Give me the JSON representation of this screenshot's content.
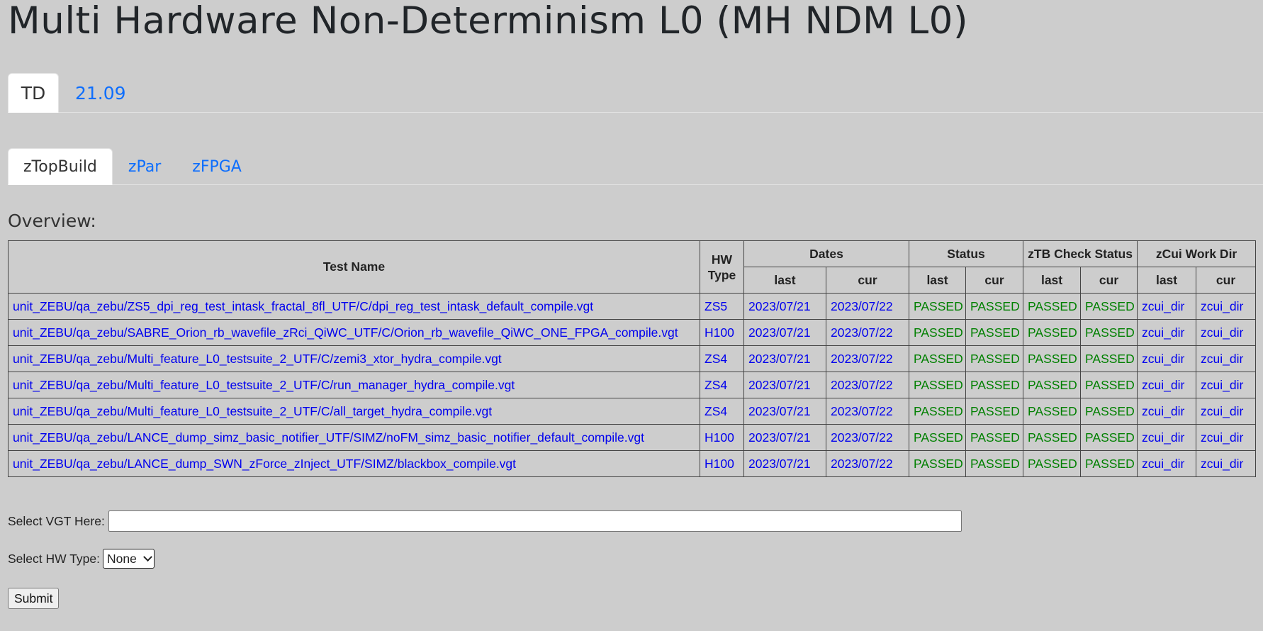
{
  "page": {
    "title": "Multi Hardware Non-Determinism L0 (MH NDM L0)"
  },
  "main_tabs": [
    {
      "label": "TD",
      "active": true
    },
    {
      "label": "21.09",
      "active": false
    }
  ],
  "sub_tabs": [
    {
      "label": "zTopBuild",
      "active": true
    },
    {
      "label": "zPar",
      "active": false
    },
    {
      "label": "zFPGA",
      "active": false
    }
  ],
  "overview": {
    "heading": "Overview:",
    "headers": {
      "test_name": "Test Name",
      "hw_type": "HW Type",
      "dates": "Dates",
      "status": "Status",
      "ztb_check_status": "zTB Check Status",
      "zcui_work_dir": "zCui Work Dir",
      "last": "last",
      "cur": "cur"
    },
    "rows": [
      {
        "test_name": "unit_ZEBU/qa_zebu/ZS5_dpi_reg_test_intask_fractal_8fl_UTF/C/dpi_reg_test_intask_default_compile.vgt",
        "hw_type": "ZS5",
        "dates_last": "2023/07/21",
        "dates_cur": "2023/07/22",
        "status_last": "PASSED",
        "status_cur": "PASSED",
        "ztb_last": "PASSED",
        "ztb_cur": "PASSED",
        "zcui_last": "zcui_dir",
        "zcui_cur": "zcui_dir"
      },
      {
        "test_name": "unit_ZEBU/qa_zebu/SABRE_Orion_rb_wavefile_zRci_QiWC_UTF/C/Orion_rb_wavefile_QiWC_ONE_FPGA_compile.vgt",
        "hw_type": "H100",
        "dates_last": "2023/07/21",
        "dates_cur": "2023/07/22",
        "status_last": "PASSED",
        "status_cur": "PASSED",
        "ztb_last": "PASSED",
        "ztb_cur": "PASSED",
        "zcui_last": "zcui_dir",
        "zcui_cur": "zcui_dir"
      },
      {
        "test_name": "unit_ZEBU/qa_zebu/Multi_feature_L0_testsuite_2_UTF/C/zemi3_xtor_hydra_compile.vgt",
        "hw_type": "ZS4",
        "dates_last": "2023/07/21",
        "dates_cur": "2023/07/22",
        "status_last": "PASSED",
        "status_cur": "PASSED",
        "ztb_last": "PASSED",
        "ztb_cur": "PASSED",
        "zcui_last": "zcui_dir",
        "zcui_cur": "zcui_dir"
      },
      {
        "test_name": "unit_ZEBU/qa_zebu/Multi_feature_L0_testsuite_2_UTF/C/run_manager_hydra_compile.vgt",
        "hw_type": "ZS4",
        "dates_last": "2023/07/21",
        "dates_cur": "2023/07/22",
        "status_last": "PASSED",
        "status_cur": "PASSED",
        "ztb_last": "PASSED",
        "ztb_cur": "PASSED",
        "zcui_last": "zcui_dir",
        "zcui_cur": "zcui_dir"
      },
      {
        "test_name": "unit_ZEBU/qa_zebu/Multi_feature_L0_testsuite_2_UTF/C/all_target_hydra_compile.vgt",
        "hw_type": "ZS4",
        "dates_last": "2023/07/21",
        "dates_cur": "2023/07/22",
        "status_last": "PASSED",
        "status_cur": "PASSED",
        "ztb_last": "PASSED",
        "ztb_cur": "PASSED",
        "zcui_last": "zcui_dir",
        "zcui_cur": "zcui_dir"
      },
      {
        "test_name": "unit_ZEBU/qa_zebu/LANCE_dump_simz_basic_notifier_UTF/SIMZ/noFM_simz_basic_notifier_default_compile.vgt",
        "hw_type": "H100",
        "dates_last": "2023/07/21",
        "dates_cur": "2023/07/22",
        "status_last": "PASSED",
        "status_cur": "PASSED",
        "ztb_last": "PASSED",
        "ztb_cur": "PASSED",
        "zcui_last": "zcui_dir",
        "zcui_cur": "zcui_dir"
      },
      {
        "test_name": "unit_ZEBU/qa_zebu/LANCE_dump_SWN_zForce_zInject_UTF/SIMZ/blackbox_compile.vgt",
        "hw_type": "H100",
        "dates_last": "2023/07/21",
        "dates_cur": "2023/07/22",
        "status_last": "PASSED",
        "status_cur": "PASSED",
        "ztb_last": "PASSED",
        "ztb_cur": "PASSED",
        "zcui_last": "zcui_dir",
        "zcui_cur": "zcui_dir"
      }
    ]
  },
  "form": {
    "vgt_label": "Select VGT Here:",
    "vgt_value": "",
    "hw_label": "Select HW Type:",
    "hw_selected": "None",
    "submit_label": "Submit"
  },
  "colors": {
    "background": "#cdcdcd",
    "link": "#0000ee",
    "tab_link": "#0d6efd",
    "passed": "#008000"
  }
}
